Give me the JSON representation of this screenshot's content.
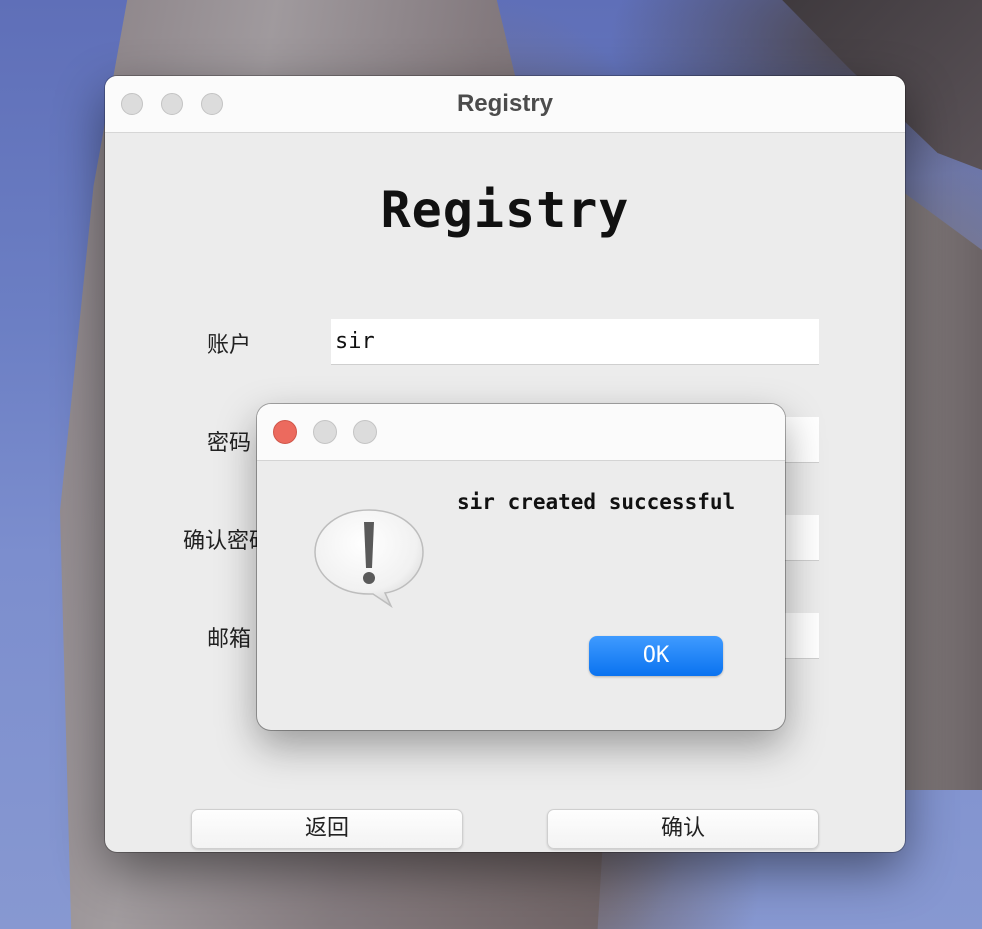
{
  "window": {
    "title": "Registry"
  },
  "form": {
    "heading": "Registry",
    "fields": [
      {
        "label": "账户",
        "value": "sir"
      },
      {
        "label": "密码",
        "value": ""
      },
      {
        "label": "确认密码",
        "value": ""
      },
      {
        "label": "邮箱",
        "value": ""
      }
    ],
    "back_label": "返回",
    "confirm_label": "确认"
  },
  "dialog": {
    "message": "sir created successful",
    "ok_label": "OK",
    "icon": "caution-icon"
  },
  "colors": {
    "accent": "#0a73f0",
    "close_button": "#ec6a5e"
  }
}
